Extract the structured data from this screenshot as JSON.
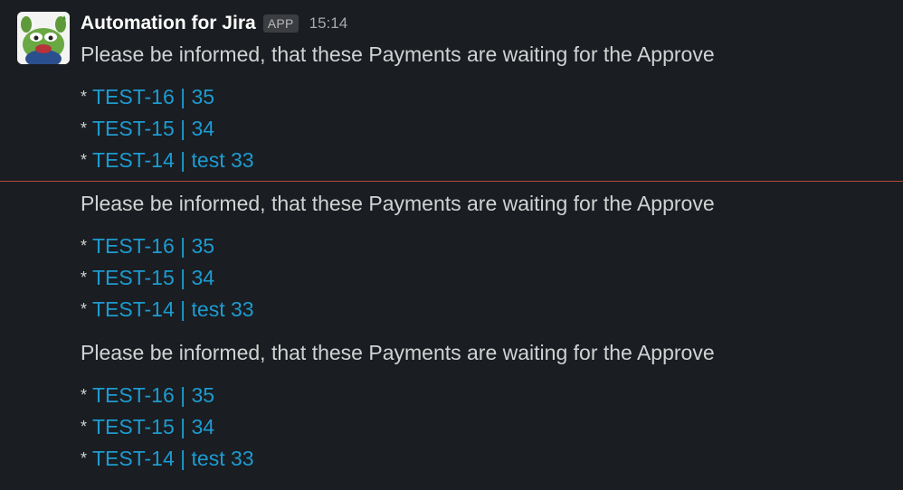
{
  "colors": {
    "background": "#1a1d21",
    "text": "#d1d2d3",
    "link": "#1d9bd1",
    "new_messages_divider": "#b24a3b"
  },
  "message_header": {
    "sender": "Automation for Jira",
    "badge": "APP",
    "time": "15:14",
    "avatar_icon": "frog-avatar-icon"
  },
  "messages": [
    {
      "text": "Please be informed, that these Payments are waiting for the Approve",
      "items": [
        {
          "bullet": "*",
          "link": "TEST-16 | 35"
        },
        {
          "bullet": "*",
          "link": "TEST-15 | 34"
        },
        {
          "bullet": "*",
          "link": "TEST-14 | test 33"
        }
      ]
    },
    {
      "text": "Please be informed, that these Payments are waiting for the Approve",
      "items": [
        {
          "bullet": "*",
          "link": "TEST-16 | 35"
        },
        {
          "bullet": "*",
          "link": "TEST-15 | 34"
        },
        {
          "bullet": "*",
          "link": "TEST-14 | test 33"
        }
      ]
    },
    {
      "text": "Please be informed, that these Payments are waiting for the Approve",
      "items": [
        {
          "bullet": "*",
          "link": "TEST-16 | 35"
        },
        {
          "bullet": "*",
          "link": "TEST-15 | 34"
        },
        {
          "bullet": "*",
          "link": "TEST-14 | test 33"
        }
      ]
    }
  ]
}
